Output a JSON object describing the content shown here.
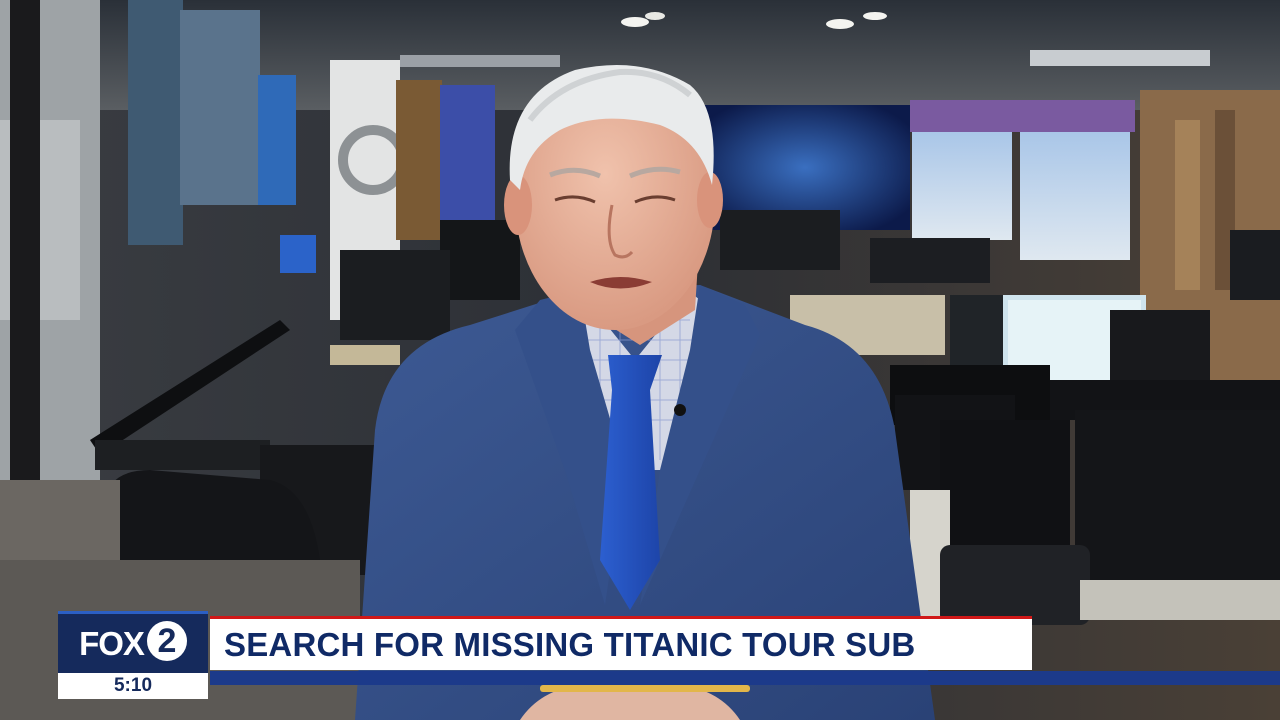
{
  "broadcast": {
    "logo_text": "FOX",
    "logo_number": "2",
    "time": "5:10",
    "headline": "SEARCH FOR MISSING TITANIC TOUR SUB"
  }
}
